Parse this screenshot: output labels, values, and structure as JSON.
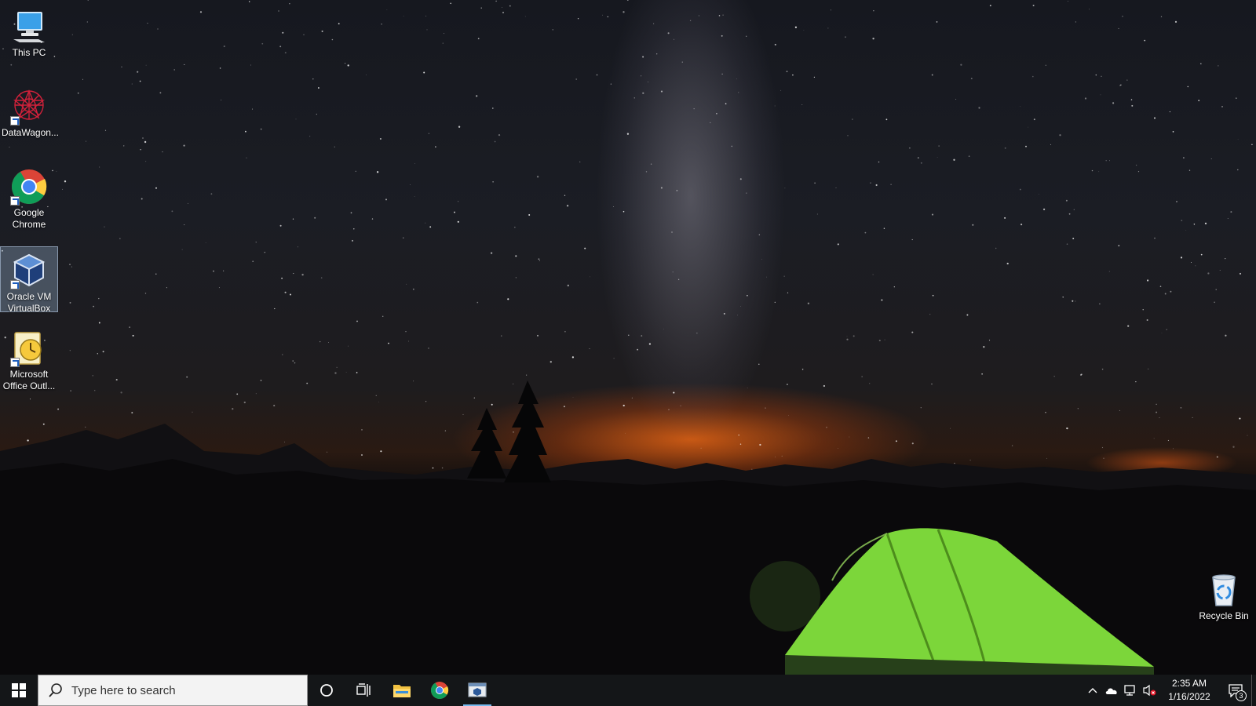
{
  "desktop": {
    "icons": [
      {
        "label": "This PC",
        "icon": "computer-icon"
      },
      {
        "label": "DataWagon...",
        "icon": "datawagon-icon"
      },
      {
        "label": "Google Chrome",
        "icon": "chrome-icon"
      },
      {
        "label": "Oracle VM VirtualBox",
        "icon": "virtualbox-icon",
        "selected": true
      },
      {
        "label": "Microsoft Office Outl...",
        "icon": "outlook-icon"
      },
      {
        "label": "Recycle Bin",
        "icon": "recycle-bin-icon"
      }
    ]
  },
  "taskbar": {
    "search_placeholder": "Type here to search",
    "pinned": [
      {
        "name": "file-explorer",
        "icon": "folder-icon"
      },
      {
        "name": "google-chrome",
        "icon": "chrome-icon"
      },
      {
        "name": "virtualbox",
        "icon": "virtualbox-icon",
        "active": true
      }
    ],
    "tray": {
      "time": "2:35 AM",
      "date": "1/16/2022",
      "notification_count": "3"
    }
  },
  "colors": {
    "taskbar_bg": "#141618",
    "accent": "#76b9ed",
    "tent_green": "#7cd63a"
  }
}
